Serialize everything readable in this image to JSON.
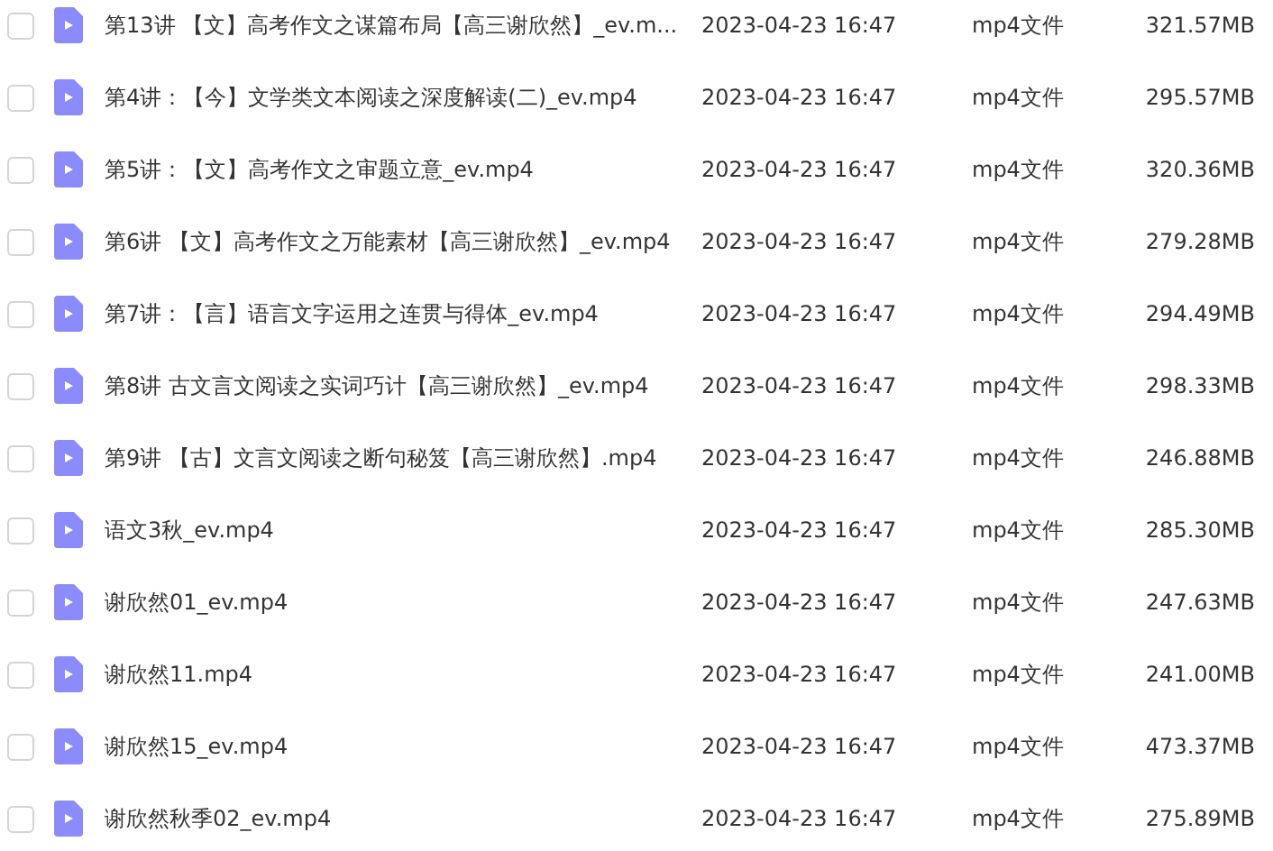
{
  "files": [
    {
      "checked": false,
      "name": "第13讲 【文】高考作文之谋篇布局【高三谢欣然】_ev.m...",
      "modified": "2023-04-23 16:47",
      "type": "mp4文件",
      "size": "321.57MB"
    },
    {
      "checked": false,
      "name": "第4讲：【今】文学类文本阅读之深度解读(二)_ev.mp4",
      "modified": "2023-04-23 16:47",
      "type": "mp4文件",
      "size": "295.57MB"
    },
    {
      "checked": false,
      "name": "第5讲：【文】高考作文之审题立意_ev.mp4",
      "modified": "2023-04-23 16:47",
      "type": "mp4文件",
      "size": "320.36MB"
    },
    {
      "checked": false,
      "name": "第6讲 【文】高考作文之万能素材【高三谢欣然】_ev.mp4",
      "modified": "2023-04-23 16:47",
      "type": "mp4文件",
      "size": "279.28MB"
    },
    {
      "checked": false,
      "name": "第7讲：【言】语言文字运用之连贯与得体_ev.mp4",
      "modified": "2023-04-23 16:47",
      "type": "mp4文件",
      "size": "294.49MB"
    },
    {
      "checked": false,
      "name": "第8讲 古文言文阅读之实词巧计【高三谢欣然】_ev.mp4",
      "modified": "2023-04-23 16:47",
      "type": "mp4文件",
      "size": "298.33MB"
    },
    {
      "checked": false,
      "name": "第9讲 【古】文言文阅读之断句秘笈【高三谢欣然】.mp4",
      "modified": "2023-04-23 16:47",
      "type": "mp4文件",
      "size": "246.88MB"
    },
    {
      "checked": false,
      "name": "语文3秋_ev.mp4",
      "modified": "2023-04-23 16:47",
      "type": "mp4文件",
      "size": "285.30MB"
    },
    {
      "checked": false,
      "name": "谢欣然01_ev.mp4",
      "modified": "2023-04-23 16:47",
      "type": "mp4文件",
      "size": "247.63MB"
    },
    {
      "checked": false,
      "name": "谢欣然11.mp4",
      "modified": "2023-04-23 16:47",
      "type": "mp4文件",
      "size": "241.00MB"
    },
    {
      "checked": false,
      "name": "谢欣然15_ev.mp4",
      "modified": "2023-04-23 16:47",
      "type": "mp4文件",
      "size": "473.37MB"
    },
    {
      "checked": false,
      "name": "谢欣然秋季02_ev.mp4",
      "modified": "2023-04-23 16:47",
      "type": "mp4文件",
      "size": "275.89MB"
    }
  ]
}
